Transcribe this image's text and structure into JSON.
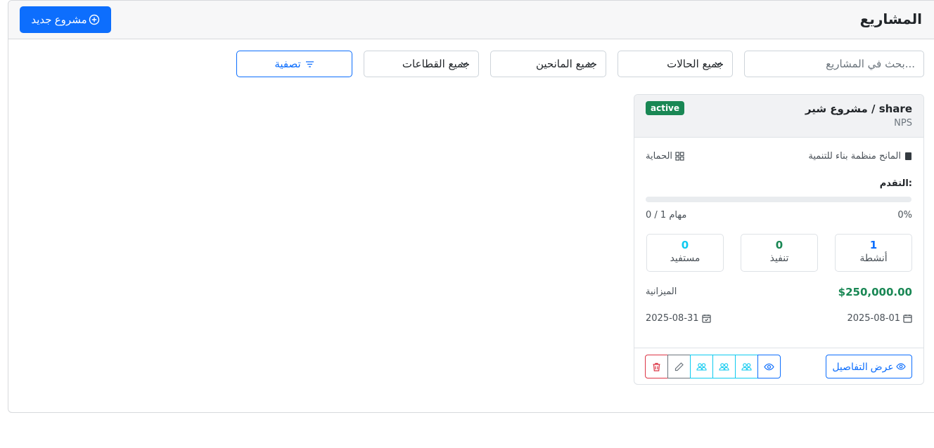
{
  "header": {
    "title": "المشاريع",
    "new_button_label": "مشروع جديد"
  },
  "filters": {
    "search_placeholder": "بحث في المشاريع...",
    "status_select": "جميع الحالات",
    "donor_select": "جميع المانحين",
    "sector_select": "جميع القطاعات",
    "filter_button": "تصفية"
  },
  "project": {
    "title": "مشروع شير / share",
    "code": "NPS",
    "status": "active",
    "donor": "المانح منظمة بناء للتنمية",
    "sector": "الحماية",
    "progress_label": "التقدم:",
    "progress_percent": 0,
    "progress_text": "0%",
    "tasks_text": "0 / 1 مهام",
    "stats": [
      {
        "value": "1",
        "label": "أنشطة",
        "color": "#0d6efd"
      },
      {
        "value": "0",
        "label": "تنفيذ",
        "color": "#198754"
      },
      {
        "value": "0",
        "label": "مستفيد",
        "color": "#0dcaf0"
      }
    ],
    "budget_value": "$250,000.00",
    "budget_label": "الميزانية",
    "start_date": "2025-08-01",
    "end_date": "2025-08-31",
    "details_button": "عرض التفاصيل"
  },
  "colors": {
    "primary": "#0d6efd",
    "success": "#198754",
    "info": "#0dcaf0",
    "danger": "#dc3545",
    "secondary": "#6c757d"
  }
}
